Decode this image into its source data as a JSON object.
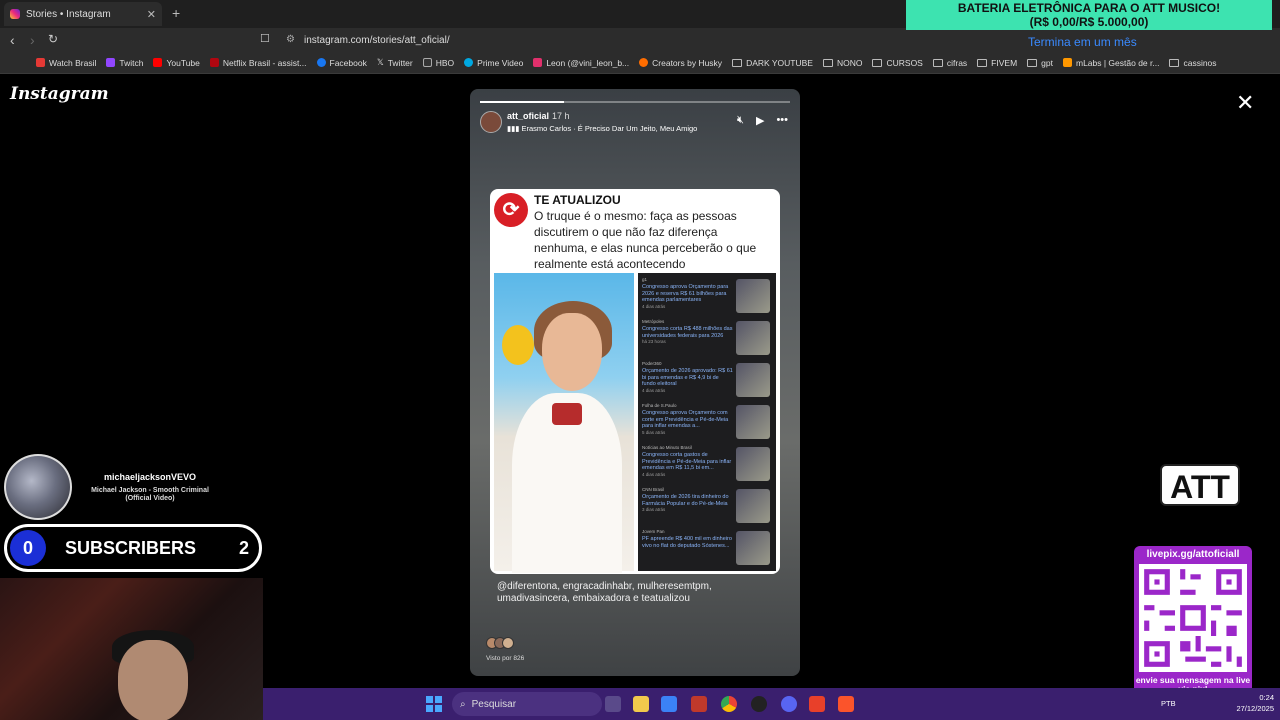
{
  "browser": {
    "tab_title": "Stories • Instagram",
    "url": "instagram.com/stories/att_oficial/",
    "bookmarks": [
      "Watch Brasil",
      "Twitch",
      "YouTube",
      "Netflix Brasil - assist...",
      "Facebook",
      "Twitter",
      "HBO",
      "Prime Video",
      "Leon (@vini_leon_b...",
      "Creators by Husky",
      "DARK YOUTUBE",
      "NONO",
      "CURSOS",
      "cifras",
      "FIVEM",
      "gpt",
      "mLabs | Gestão de r...",
      "cassinos"
    ]
  },
  "promo": {
    "line1": "BATERIA ELETRÔNICA PARA O ATT MUSICO!",
    "line2": "(R$ 0,00/R$ 5.000,00)",
    "ends": "Termina em um mês"
  },
  "instagram": {
    "logo": "Instagram",
    "story": {
      "username": "att_oficial",
      "time": "17 h",
      "music": "Erasmo Carlos · É Preciso Dar Um Jeito, Meu Amigo",
      "progress": 0.27,
      "card": {
        "brand": "TE ATUALIZOU",
        "text": "O truque é o mesmo: faça as pessoas discutirem o que não faz diferença nenhuma, e elas nunca perceberão o que realmente está acontecendo"
      },
      "news": [
        {
          "source": "g1",
          "title": "Congresso aprova Orçamento para 2026 e reserva R$ 61 bilhões para emendas parlamentares",
          "age": "4 dias atrás"
        },
        {
          "source": "Metrópoles",
          "title": "Congresso corta R$ 488 milhões das universidades federais para 2026",
          "age": "há 23 horas"
        },
        {
          "source": "Poder360",
          "title": "Orçamento de 2026 aprovado: R$ 61 bi para emendas e R$ 4,9 bi de fundo eleitoral",
          "age": "4 dias atrás"
        },
        {
          "source": "Folha de S.Paulo",
          "title": "Congresso aprova Orçamento com corte em Previdência e Pé-de-Meia para inflar emendas a...",
          "age": "5 dias atrás"
        },
        {
          "source": "Notícias ao Minuto Brasil",
          "title": "Congresso corta gastos de Previdência e Pé-de-Meia para inflar emendas em R$ 11,5 bi em...",
          "age": "4 dias atrás"
        },
        {
          "source": "CNN Brasil",
          "title": "Orçamento de 2026 tira dinheiro do Farmácia Popular e do Pé-de-Meia",
          "age": "3 dias atrás"
        },
        {
          "source": "Jovem Pan",
          "title": "PF apreende R$ 400 mil em dinheiro vivo no flat do deputado Sóstenes...",
          "age": ""
        }
      ],
      "tags": "@diferentona, engracadinhabr, mulheresemtpm, umadivasincera, embaixadora e teatualizou",
      "seen_by": "Visto por 826"
    }
  },
  "stream": {
    "yt_channel": "michaeljacksonVEVO",
    "yt_song": "Michael Jackson - Smooth Criminal (Official Video)",
    "subs_current": "0",
    "subs_label": "SUBSCRIBERS",
    "subs_goal": "2",
    "att_logo": "ATT",
    "livepix_url": "livepix.gg/attoficiall",
    "livepix_msg": "envie sua mensagem na live via pix!"
  },
  "taskbar": {
    "search_placeholder": "Pesquisar",
    "lang": "PTB",
    "time": "0:24",
    "date": "27/12/2025"
  },
  "colors": {
    "promo_bg": "#3de3b0",
    "subs_circle": "#1b2fd6",
    "livepix_bg": "#9b27c9",
    "taskbar_bg": "#3a1f6e",
    "news_link": "#8ab4f8"
  }
}
